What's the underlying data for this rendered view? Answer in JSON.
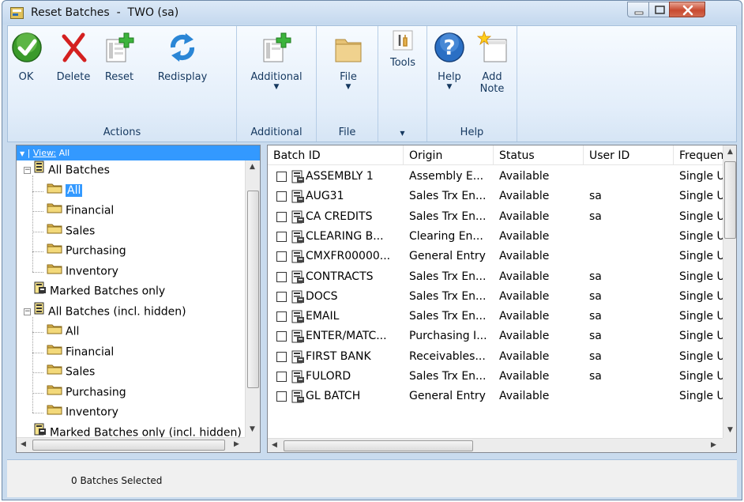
{
  "window": {
    "title": "Reset Batches  -  TWO (sa)"
  },
  "ribbon": {
    "groups": [
      {
        "label": "Actions",
        "buttons": [
          "OK",
          "Delete",
          "Reset",
          "Redisplay"
        ]
      },
      {
        "label": "Additional",
        "buttons": [
          "Additional"
        ]
      },
      {
        "label": "File",
        "buttons": [
          "File"
        ]
      },
      {
        "label": "",
        "buttons": [
          "Tools"
        ]
      },
      {
        "label": "Help",
        "buttons": [
          "Help",
          "Add\nNote"
        ]
      }
    ]
  },
  "view_bar": {
    "prefix": "View:",
    "value": "All"
  },
  "tree": [
    {
      "label": "All Batches",
      "level": 0,
      "expander": "−"
    },
    {
      "label": "All",
      "level": 1,
      "selected": true
    },
    {
      "label": "Financial",
      "level": 1
    },
    {
      "label": "Sales",
      "level": 1
    },
    {
      "label": "Purchasing",
      "level": 1
    },
    {
      "label": "Inventory",
      "level": 1
    },
    {
      "label": "Marked Batches only",
      "level": 0
    },
    {
      "label": "All Batches (incl. hidden)",
      "level": 0,
      "expander": "−"
    },
    {
      "label": "All",
      "level": 1
    },
    {
      "label": "Financial",
      "level": 1
    },
    {
      "label": "Sales",
      "level": 1
    },
    {
      "label": "Purchasing",
      "level": 1
    },
    {
      "label": "Inventory",
      "level": 1
    },
    {
      "label": "Marked Batches only (incl. hidden)",
      "level": 0
    }
  ],
  "grid": {
    "columns": [
      "Batch ID",
      "Origin",
      "Status",
      "User ID",
      "Frequency"
    ],
    "rows": [
      [
        "ASSEMBLY 1",
        "Assembly E...",
        "Available",
        "",
        "Single Use"
      ],
      [
        "AUG31",
        "Sales Trx En...",
        "Available",
        "sa",
        "Single Use"
      ],
      [
        "CA CREDITS",
        "Sales Trx En...",
        "Available",
        "sa",
        "Single Use"
      ],
      [
        "CLEARING B...",
        "Clearing En...",
        "Available",
        "",
        "Single Use"
      ],
      [
        "CMXFR00000...",
        "General Entry",
        "Available",
        "",
        "Single Use"
      ],
      [
        "CONTRACTS",
        "Sales Trx En...",
        "Available",
        "sa",
        "Single Use"
      ],
      [
        "DOCS",
        "Sales Trx En...",
        "Available",
        "sa",
        "Single Use"
      ],
      [
        "EMAIL",
        "Sales Trx En...",
        "Available",
        "sa",
        "Single Use"
      ],
      [
        "ENTER/MATC...",
        "Purchasing I...",
        "Available",
        "sa",
        "Single Use"
      ],
      [
        "FIRST BANK",
        "Receivables...",
        "Available",
        "sa",
        "Single Use"
      ],
      [
        "FULORD",
        "Sales Trx En...",
        "Available",
        "sa",
        "Single Use"
      ],
      [
        "GL BATCH",
        "General Entry",
        "Available",
        "",
        "Single Use"
      ]
    ]
  },
  "status": {
    "text": "0 Batches Selected"
  },
  "icons": {
    "ok": "ok-check-icon",
    "delete": "delete-x-icon",
    "reset": "reset-grid-icon",
    "redisplay": "refresh-arrows-icon",
    "additional": "additional-grid-icon",
    "file": "folder-icon",
    "tools": "tools-icon",
    "help": "help-question-icon",
    "note": "add-note-icon",
    "batch": "batch-icon",
    "folder_tree": "folder-icon"
  },
  "colors": {
    "selection": "#3399ff",
    "accent": "#15385f",
    "ok_green": "#3a9a2a",
    "delete_red": "#d42020"
  }
}
